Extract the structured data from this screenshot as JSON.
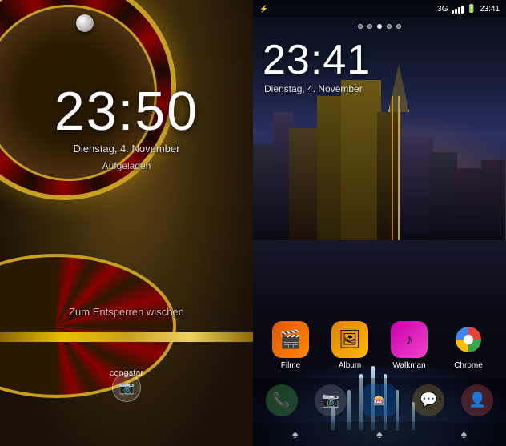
{
  "left_screen": {
    "time": "23:50",
    "date": "Dienstag, 4. November",
    "charged_label": "Aufgeladen",
    "swipe_label": "Zum Entsperren wischen",
    "carrier": "congstar"
  },
  "right_screen": {
    "time": "23:41",
    "date": "Dienstag, 4. November",
    "status": {
      "network": "3G",
      "battery": "■■■",
      "clock": "23:41"
    },
    "dots": [
      {
        "active": false
      },
      {
        "active": false
      },
      {
        "active": true
      },
      {
        "active": false
      },
      {
        "active": false
      }
    ],
    "apps": [
      {
        "id": "filme",
        "label": "Filme",
        "icon": "🎬"
      },
      {
        "id": "album",
        "label": "Album",
        "icon": "🖼"
      },
      {
        "id": "walkman",
        "label": "Walkman",
        "icon": "🎵"
      },
      {
        "id": "chrome",
        "label": "Chrome",
        "icon": "chrome"
      }
    ],
    "dock": [
      {
        "id": "phone",
        "icon": "📞"
      },
      {
        "id": "camera",
        "icon": "📷"
      },
      {
        "id": "slots",
        "icon": "🎰"
      },
      {
        "id": "chat",
        "icon": "💬"
      },
      {
        "id": "contacts",
        "icon": "👤"
      }
    ]
  }
}
